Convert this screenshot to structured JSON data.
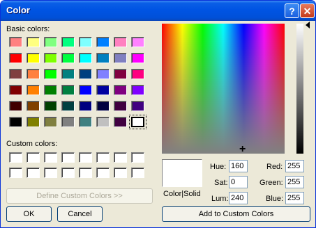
{
  "window": {
    "title": "Color"
  },
  "titlebar": {
    "help_glyph": "?",
    "close_glyph": "✕"
  },
  "labels": {
    "basic_colors": "Basic colors:",
    "custom_colors": "Custom colors:",
    "color_solid": "Color|Solid",
    "hue": "Hue:",
    "sat": "Sat:",
    "lum": "Lum:",
    "red": "Red:",
    "green": "Green:",
    "blue": "Blue:"
  },
  "values": {
    "hue": "160",
    "sat": "0",
    "lum": "240",
    "red": "255",
    "green": "255",
    "blue": "255"
  },
  "buttons": {
    "define_custom": "Define Custom Colors >>",
    "ok": "OK",
    "cancel": "Cancel",
    "add_custom": "Add to Custom Colors"
  },
  "basic_colors": [
    "#ff8080",
    "#ffff80",
    "#80ff80",
    "#00ff80",
    "#80ffff",
    "#0080ff",
    "#ff80c0",
    "#ff80ff",
    "#ff0000",
    "#ffff00",
    "#80ff00",
    "#00ff40",
    "#00ffff",
    "#0080c0",
    "#8080c0",
    "#ff00ff",
    "#804040",
    "#ff8040",
    "#00ff00",
    "#008080",
    "#004080",
    "#8080ff",
    "#800040",
    "#ff0080",
    "#800000",
    "#ff8000",
    "#008000",
    "#008040",
    "#0000ff",
    "#0000a0",
    "#800080",
    "#8000ff",
    "#400000",
    "#804000",
    "#004000",
    "#004040",
    "#000080",
    "#000040",
    "#400040",
    "#400080",
    "#000000",
    "#808000",
    "#808040",
    "#808080",
    "#408080",
    "#c0c0c0",
    "#400040",
    "#ffffff"
  ],
  "selected_basic_index": 47
}
